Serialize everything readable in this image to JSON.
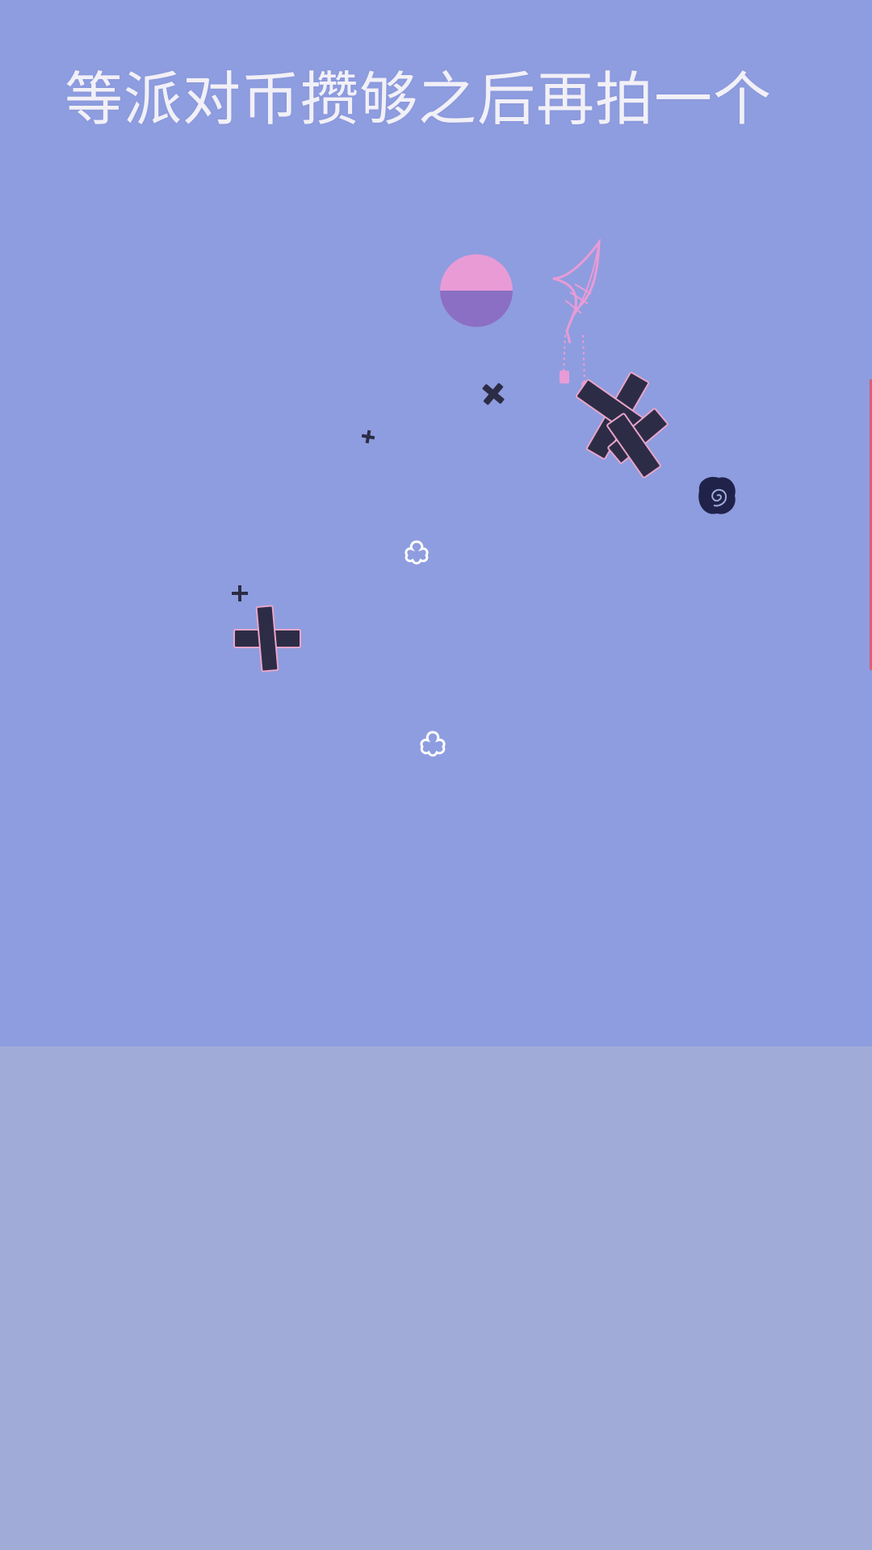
{
  "caption": {
    "text": "等派对币攒够之后再拍一个"
  },
  "colors": {
    "background_upper": "#8E9DDF",
    "background_lower": "#A1ABD8",
    "caption_text": "#F2F0F7",
    "ornament_orb_pink": "#E99BD6",
    "ornament_orb_purple": "#8A6FC4",
    "bandage_fill": "#2D2C47",
    "bandage_outline": "#E8A5C9",
    "flower_outline": "#FFFFFF",
    "rose_dark": "#20224A",
    "edge_accent": "#E05A7A"
  },
  "decorations": [
    "pink-orb-ornament",
    "pink-feather-charm-icon",
    "bandage-cross-small-icon",
    "bandage-cross-tiny-icon",
    "bandage-cross-large-icon",
    "bandage-cross-medium-icon",
    "dark-rose-icon",
    "flower-outline-icon",
    "sparkle-cross-icon"
  ]
}
